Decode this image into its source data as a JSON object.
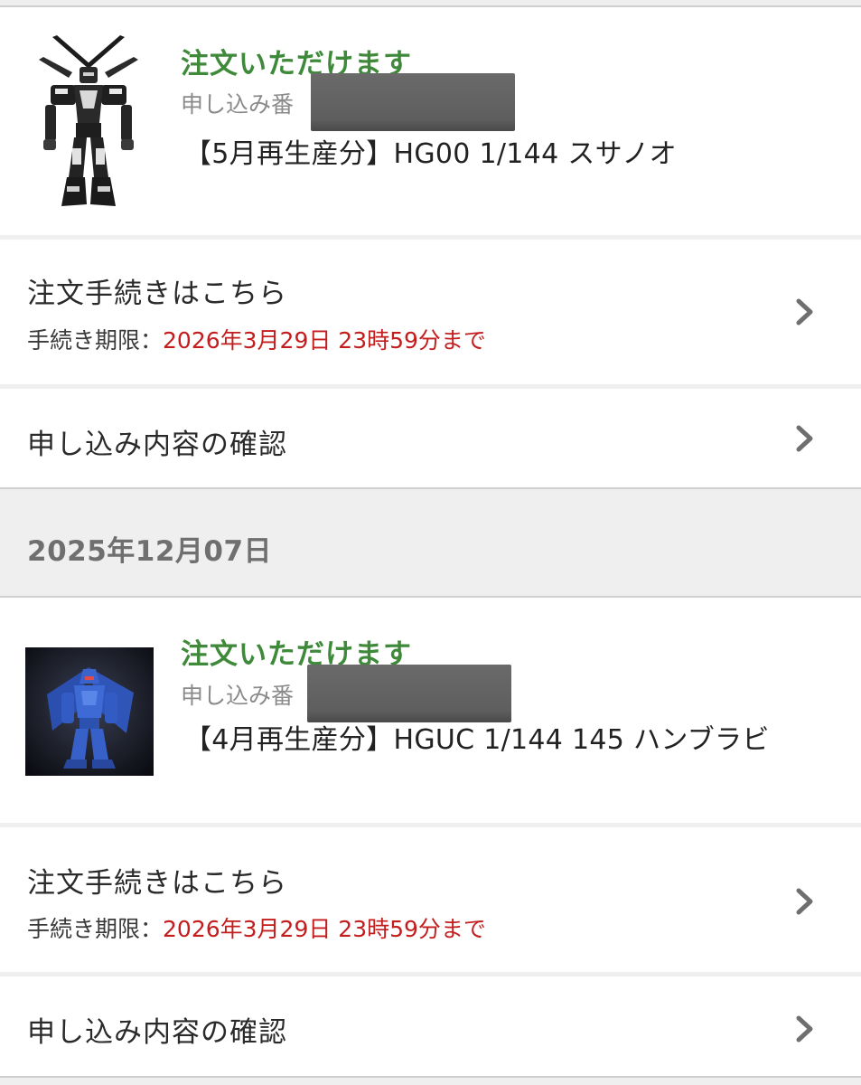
{
  "orders": [
    {
      "status": "注文いただけます",
      "application_label": "申し込み番",
      "product_name": "【5月再生産分】HG00 1/144 スサノオ",
      "procedure_link": "注文手続きはこちら",
      "deadline_label": "手続き期限：",
      "deadline_value": "2026年3月29日 23時59分まで",
      "confirm_link": "申し込み内容の確認",
      "thumb_icon": "robot-figure-dark"
    },
    {
      "status": "注文いただけます",
      "application_label": "申し込み番",
      "product_name": "【4月再生産分】HGUC 1/144 145 ハンブラビ",
      "procedure_link": "注文手続きはこちら",
      "deadline_label": "手続き期限：",
      "deadline_value": "2026年3月29日 23時59分まで",
      "confirm_link": "申し込み内容の確認",
      "thumb_icon": "robot-figure-blue"
    }
  ],
  "date_header": "2025年12月07日",
  "colors": {
    "status_green": "#3f8a3a",
    "deadline_red": "#c41d1d",
    "section_bg": "#efefef"
  }
}
